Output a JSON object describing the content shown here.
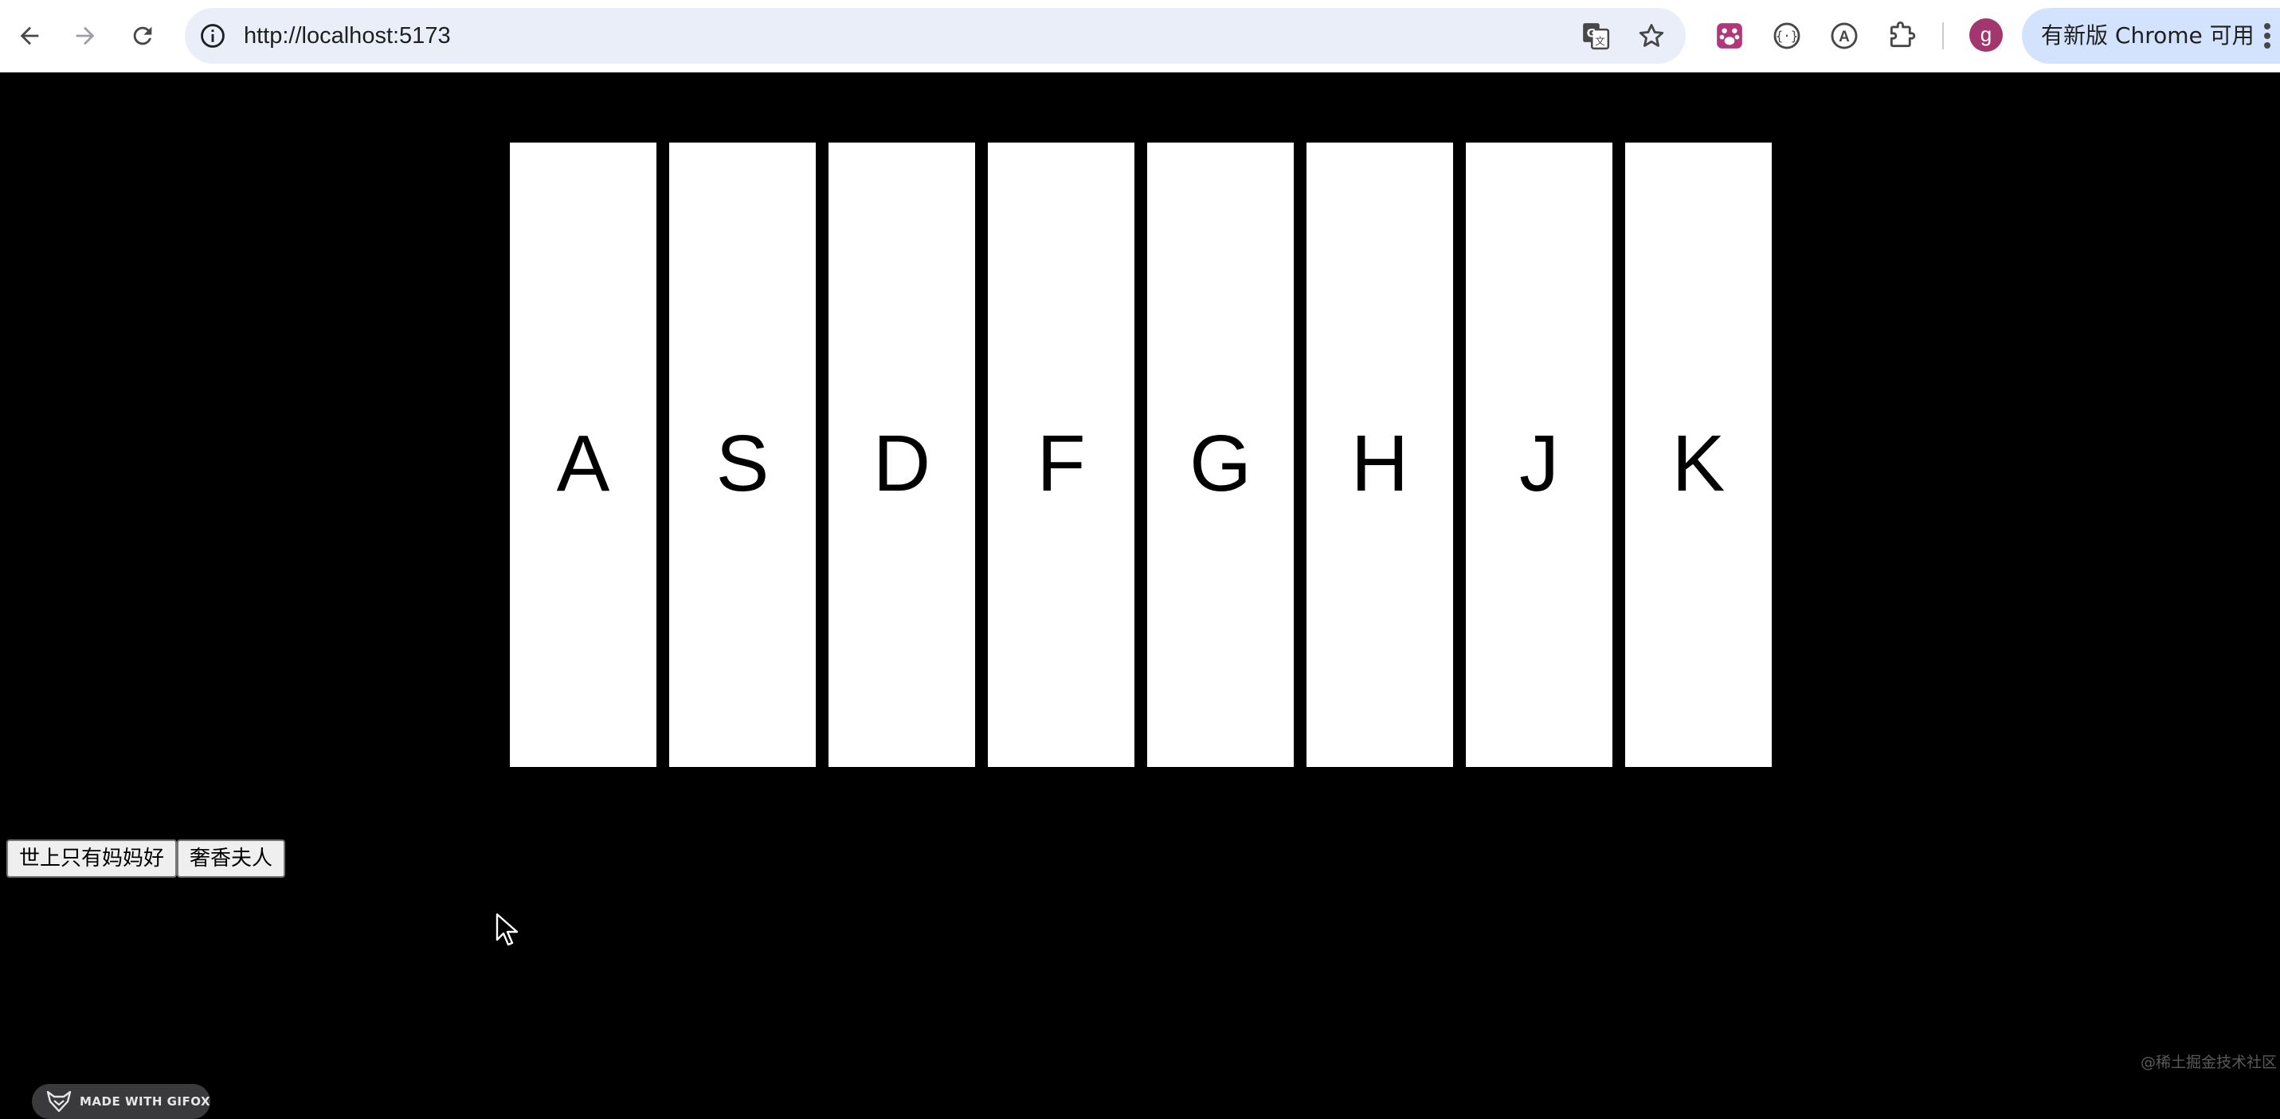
{
  "browser": {
    "url": "http://localhost:5173",
    "update_button_label": "有新版 Chrome 可用",
    "avatar_letter": "g"
  },
  "piano": {
    "keys": [
      {
        "label": "A"
      },
      {
        "label": "S"
      },
      {
        "label": "D"
      },
      {
        "label": "F"
      },
      {
        "label": "G"
      },
      {
        "label": "H"
      },
      {
        "label": "J"
      },
      {
        "label": "K"
      }
    ]
  },
  "songs": [
    {
      "label": "世上只有妈妈好"
    },
    {
      "label": "奢香夫人"
    }
  ],
  "gifox_badge": {
    "label": "MADE WITH GIFOX"
  },
  "watermark": {
    "text": "@稀土掘金技术社区"
  },
  "colors": {
    "page_background": "#000000",
    "key_background": "#ffffff",
    "omnibox_background": "#e9eef8",
    "update_button_background": "#d3e3fd",
    "avatar_background": "#a3366f"
  }
}
